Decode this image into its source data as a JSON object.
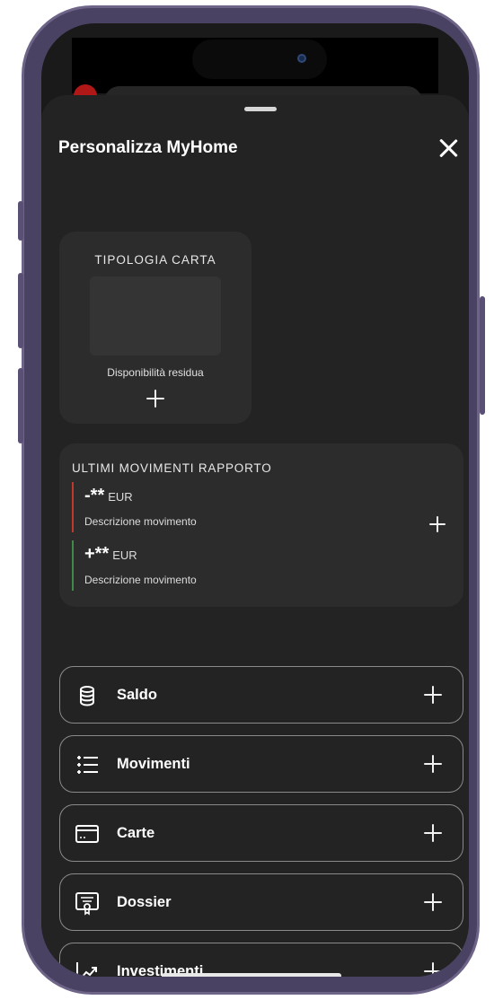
{
  "sheet": {
    "title": "Personalizza MyHome",
    "close_icon": "close-icon"
  },
  "card_widget": {
    "title": "TIPOLOGIA CARTA",
    "subtitle": "Disponibilità residua",
    "add_icon": "plus-icon"
  },
  "movements_widget": {
    "title": "ULTIMI MOVIMENTI RAPPORTO",
    "items": [
      {
        "sign": "-**",
        "currency": "EUR",
        "description": "Descrizione movimento",
        "color": "#c0392b"
      },
      {
        "sign": "+**",
        "currency": "EUR",
        "description": "Descrizione movimento",
        "color": "#3f8a4a"
      }
    ],
    "add_icon": "plus-icon"
  },
  "list": [
    {
      "label": "Saldo",
      "icon": "database-icon"
    },
    {
      "label": "Movimenti",
      "icon": "list-icon"
    },
    {
      "label": "Carte",
      "icon": "credit-card-icon"
    },
    {
      "label": "Dossier",
      "icon": "certificate-icon"
    },
    {
      "label": "Investimenti",
      "icon": "trending-up-icon"
    }
  ],
  "colors": {
    "sheet_background": "#232323",
    "widget_background": "#2c2c2c",
    "negative": "#c0392b",
    "positive": "#3f8a4a"
  }
}
